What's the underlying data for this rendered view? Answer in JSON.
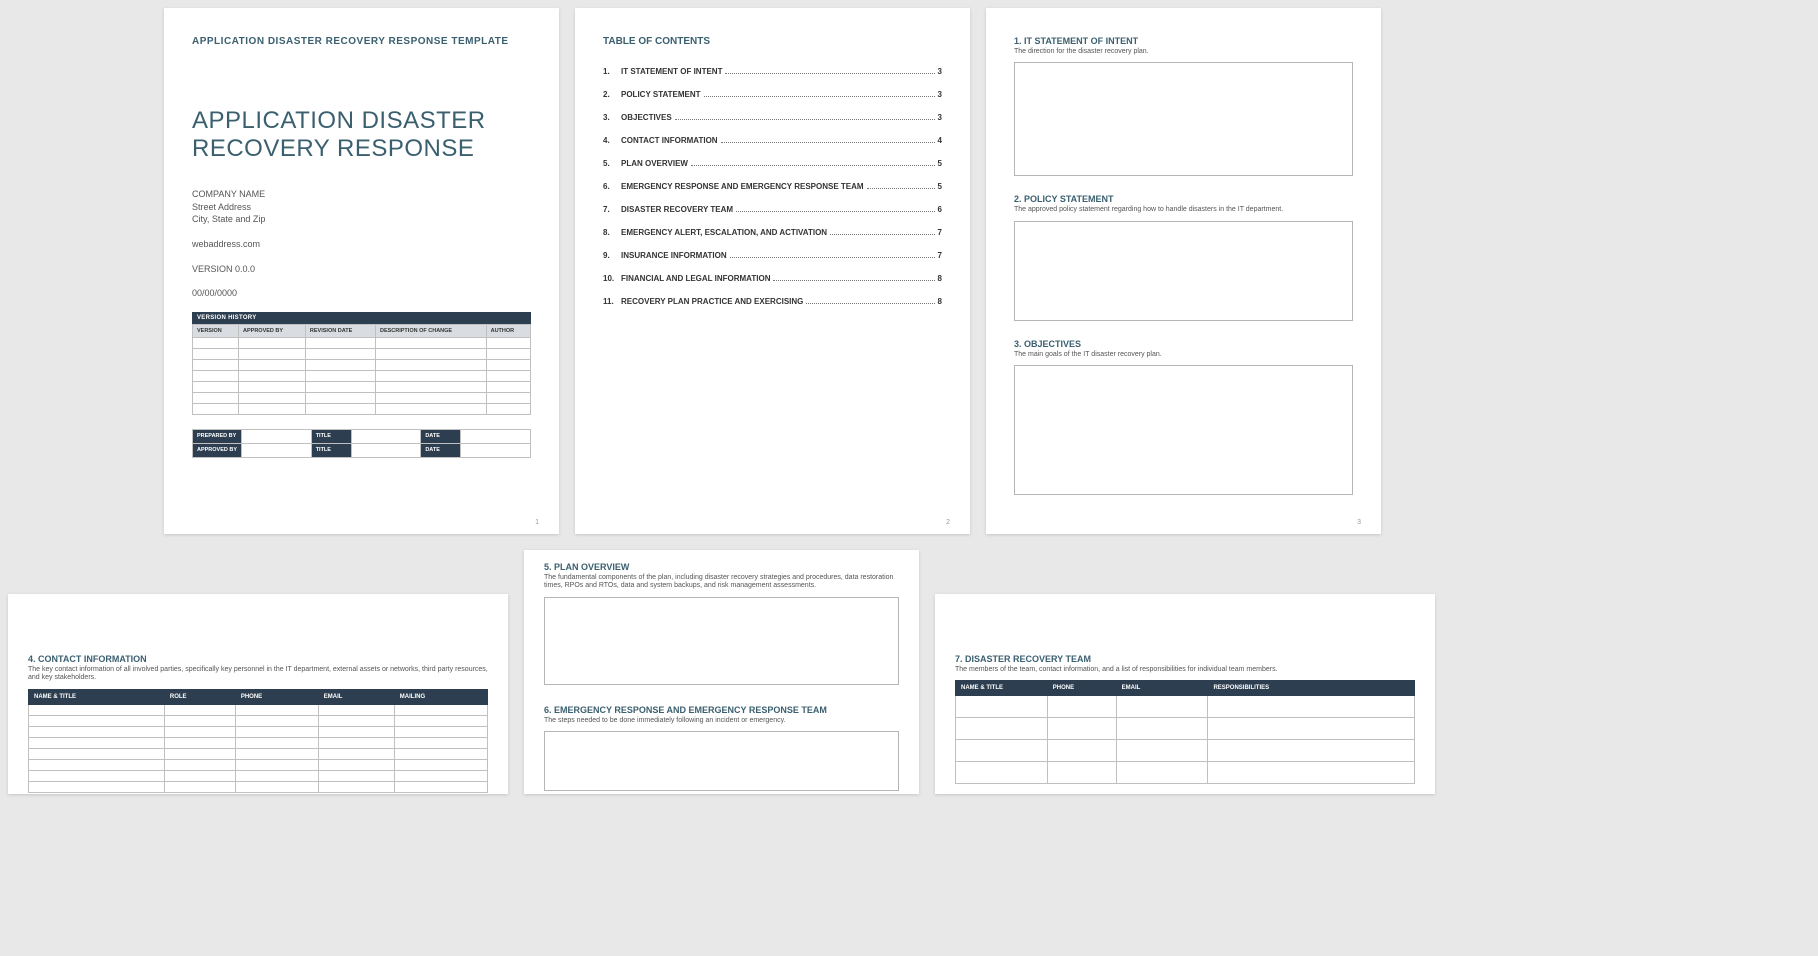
{
  "page1": {
    "template_label": "APPLICATION DISASTER RECOVERY RESPONSE TEMPLATE",
    "title_line1": "APPLICATION DISASTER",
    "title_line2": "RECOVERY RESPONSE",
    "company": "COMPANY NAME",
    "street": "Street Address",
    "city": "City, State and Zip",
    "web": "webaddress.com",
    "version": "VERSION 0.0.0",
    "date": "00/00/0000",
    "vh_title": "VERSION HISTORY",
    "vh_headers": [
      "VERSION",
      "APPROVED BY",
      "REVISION DATE",
      "DESCRIPTION OF CHANGE",
      "AUTHOR"
    ],
    "sig_prepared": "PREPARED BY",
    "sig_approved": "APPROVED BY",
    "sig_title": "TITLE",
    "sig_date": "DATE",
    "page_num": "1"
  },
  "page2": {
    "toc_title": "TABLE OF CONTENTS",
    "items": [
      {
        "n": "1.",
        "label": "IT STATEMENT OF INTENT",
        "p": "3"
      },
      {
        "n": "2.",
        "label": "POLICY STATEMENT",
        "p": "3"
      },
      {
        "n": "3.",
        "label": "OBJECTIVES",
        "p": "3"
      },
      {
        "n": "4.",
        "label": "CONTACT INFORMATION",
        "p": "4"
      },
      {
        "n": "5.",
        "label": "PLAN OVERVIEW",
        "p": "5"
      },
      {
        "n": "6.",
        "label": "EMERGENCY RESPONSE AND EMERGENCY RESPONSE TEAM",
        "p": "5"
      },
      {
        "n": "7.",
        "label": "DISASTER RECOVERY TEAM",
        "p": "6"
      },
      {
        "n": "8.",
        "label": "EMERGENCY ALERT, ESCALATION, AND ACTIVATION",
        "p": "7"
      },
      {
        "n": "9.",
        "label": "INSURANCE INFORMATION",
        "p": "7"
      },
      {
        "n": "10.",
        "label": "FINANCIAL AND LEGAL INFORMATION",
        "p": "8"
      },
      {
        "n": "11.",
        "label": "RECOVERY PLAN PRACTICE AND EXERCISING",
        "p": "8"
      }
    ],
    "page_num": "2"
  },
  "page3": {
    "s1_h": "1.  IT STATEMENT OF INTENT",
    "s1_d": "The direction for the disaster recovery plan.",
    "s2_h": "2.  POLICY STATEMENT",
    "s2_d": "The approved policy statement regarding how to handle disasters in the IT department.",
    "s3_h": "3.  OBJECTIVES",
    "s3_d": "The main goals of the IT disaster recovery plan.",
    "page_num": "3"
  },
  "page4": {
    "h": "4.  CONTACT INFORMATION",
    "d": "The key contact information of all involved parties, specifically key personnel in the IT department, external assets or networks, third party resources, and key stakeholders.",
    "headers": [
      "NAME & TITLE",
      "ROLE",
      "PHONE",
      "EMAIL",
      "MAILING"
    ]
  },
  "page5": {
    "s5_h": "5.  PLAN OVERVIEW",
    "s5_d": "The fundamental components of the plan, including disaster recovery strategies and procedures, data restoration times, RPOs and RTOs, data and system backups, and risk management assessments.",
    "s6_h": "6.  EMERGENCY RESPONSE AND EMERGENCY RESPONSE TEAM",
    "s6_d": "The steps needed to be done immediately following an incident or emergency."
  },
  "page6": {
    "h": "7.  DISASTER RECOVERY TEAM",
    "d": "The members of the team, contact information, and a list of responsibilities for individual team members.",
    "headers": [
      "NAME & TITLE",
      "PHONE",
      "EMAIL",
      "RESPONSIBILITIES"
    ]
  }
}
